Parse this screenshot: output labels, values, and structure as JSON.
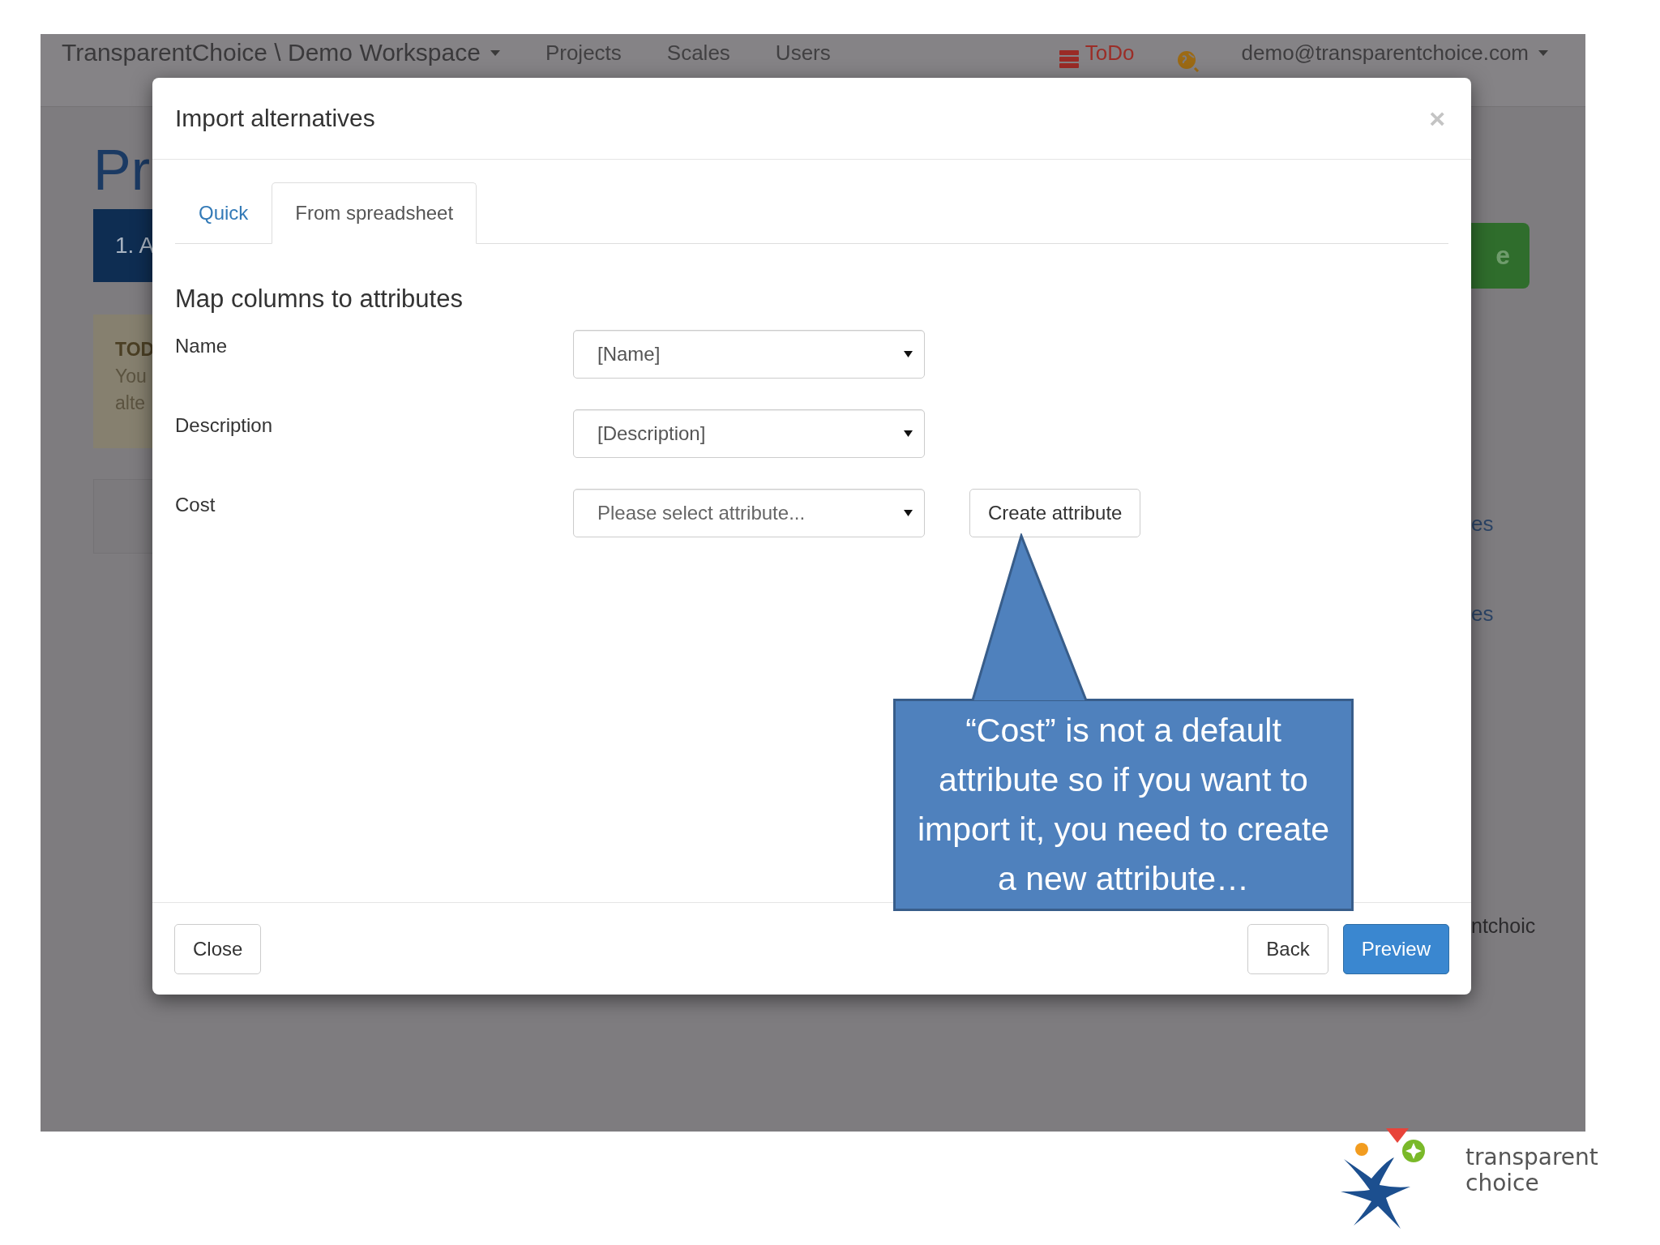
{
  "background_page": {
    "navbar": {
      "brand": "TransparentChoice \\ Demo Workspace",
      "links": [
        "Projects",
        "Scales",
        "Users"
      ],
      "todo": "ToDo",
      "user": "demo@transparentchoice.com"
    },
    "heading": "Pr",
    "step": "1. A",
    "todo_box": {
      "title": "TOD",
      "lines": [
        "You",
        "alte"
      ]
    },
    "green_button": "e",
    "links": [
      "es",
      "es"
    ],
    "footer_text": "ntchoic"
  },
  "modal": {
    "title": "Import alternatives",
    "close": "×",
    "tabs": [
      {
        "label": "Quick",
        "selected": false
      },
      {
        "label": "From spreadsheet",
        "selected": true
      }
    ],
    "section_title": "Map columns to attributes",
    "rows": [
      {
        "label": "Name",
        "value": "[Name]",
        "placeholder_shown": false
      },
      {
        "label": "Description",
        "value": "[Description]",
        "placeholder_shown": false
      },
      {
        "label": "Cost",
        "value": "Please select attribute...",
        "placeholder_shown": true,
        "action": "Create attribute"
      }
    ],
    "footer_buttons": [
      {
        "label": "Close",
        "kind": "default"
      },
      {
        "label": "Back",
        "kind": "default"
      },
      {
        "label": "Preview",
        "kind": "primary"
      }
    ]
  },
  "callout": {
    "text": "“Cost” is not a default attribute so if you want to import it, you need to create a new attribute…"
  },
  "logo": {
    "text": "transparent choice"
  }
}
